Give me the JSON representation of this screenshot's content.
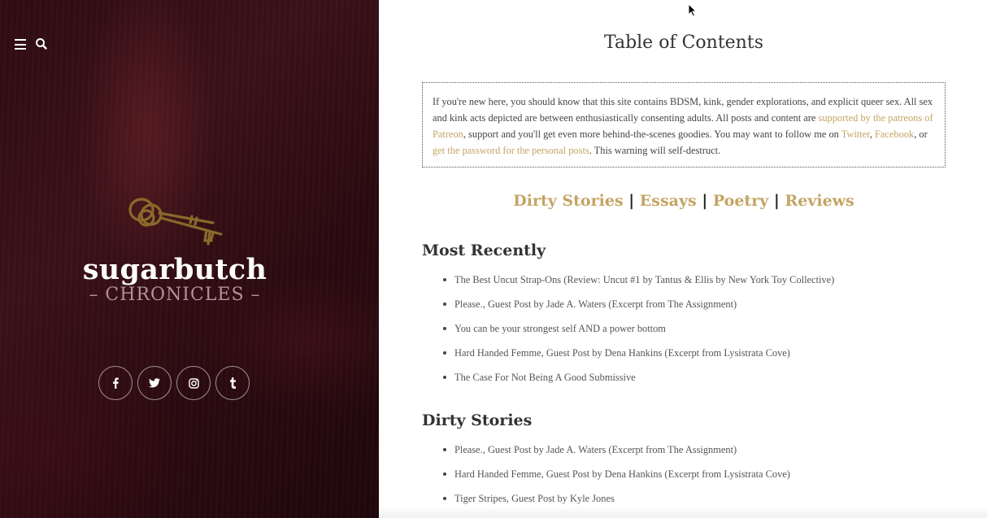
{
  "sidebar": {
    "menu_icon": "hamburger-menu-icon",
    "search_icon": "search-icon",
    "logo_icon": "skeleton-keys-icon",
    "brand_title": "sugarbutch",
    "brand_subtitle": "– CHRONICLES –",
    "social": [
      {
        "icon": "facebook-icon",
        "glyph": "f"
      },
      {
        "icon": "twitter-icon",
        "glyph": "🐦"
      },
      {
        "icon": "instagram-icon",
        "glyph": "◎"
      },
      {
        "icon": "tumblr-icon",
        "glyph": "t"
      }
    ]
  },
  "main": {
    "page_title": "Table of Contents",
    "notice": {
      "text_1": "If you're new here, you should know that this site contains BDSM, kink, gender explorations, and explicit queer sex. All sex and kink acts depicted are between enthusiastically consenting adults. All posts and content are ",
      "link_patreon": "supported by the patreons of Patreon",
      "text_2": ", support and you'll get even more behind-the-scenes goodies. You may want to follow me on ",
      "link_twitter": "Twitter",
      "text_3": ", ",
      "link_facebook": "Facebook",
      "text_4": ", or ",
      "link_password": "get the password for the personal posts",
      "text_5": ". This warning will self-destruct."
    },
    "categories": [
      "Dirty Stories",
      "Essays",
      "Poetry",
      "Reviews"
    ],
    "separator": "|",
    "sections": [
      {
        "heading": "Most Recently",
        "posts": [
          "The Best Uncut Strap-Ons (Review: Uncut #1 by Tantus & Ellis by New York Toy Collective)",
          "Please., Guest Post by Jade A. Waters (Excerpt from The Assignment)",
          "You can be your strongest self AND a power bottom",
          "Hard Handed Femme, Guest Post by Dena Hankins (Excerpt from Lysistrata Cove)",
          "The Case For Not Being A Good Submissive"
        ]
      },
      {
        "heading": "Dirty Stories",
        "posts": [
          "Please., Guest Post by Jade A. Waters (Excerpt from The Assignment)",
          "Hard Handed Femme, Guest Post by Dena Hankins (Excerpt from Lysistrata Cove)",
          "Tiger Stripes, Guest Post by Kyle Jones"
        ]
      }
    ]
  },
  "colors": {
    "accent_gold": "#c4a464",
    "sidebar_dark": "#2e0c12",
    "subtitle_mauve": "#b5909a"
  }
}
